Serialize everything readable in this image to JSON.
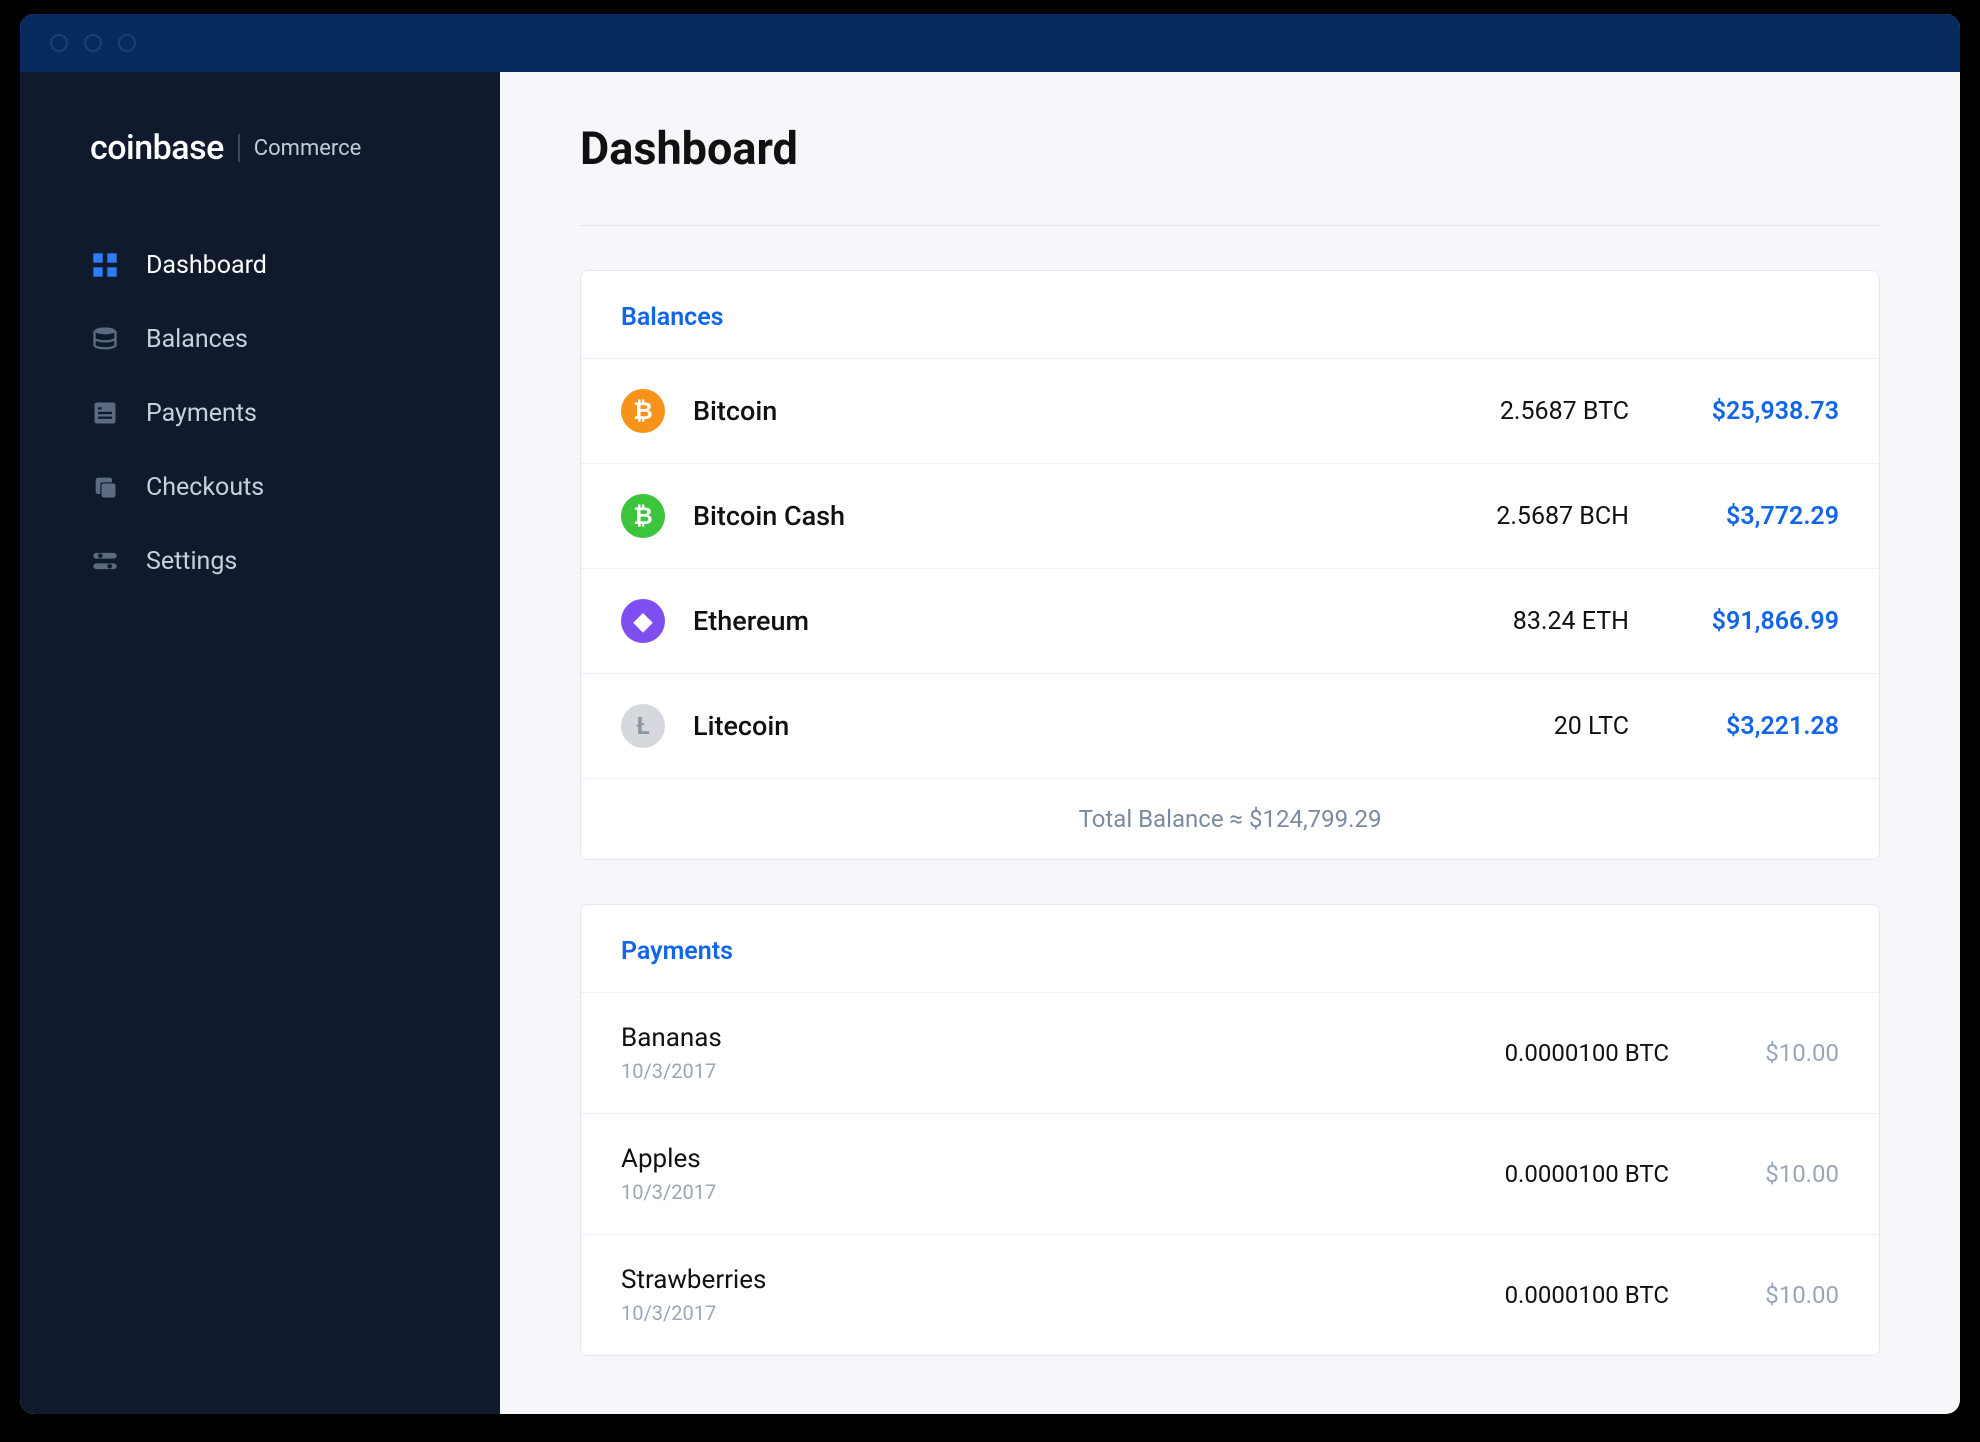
{
  "brand": {
    "primary": "coinbase",
    "secondary": "Commerce"
  },
  "sidebar": {
    "items": [
      {
        "label": "Dashboard",
        "icon": "dashboard-icon",
        "active": true
      },
      {
        "label": "Balances",
        "icon": "balances-icon",
        "active": false
      },
      {
        "label": "Payments",
        "icon": "payments-icon",
        "active": false
      },
      {
        "label": "Checkouts",
        "icon": "checkouts-icon",
        "active": false
      },
      {
        "label": "Settings",
        "icon": "settings-icon",
        "active": false
      }
    ]
  },
  "page": {
    "title": "Dashboard"
  },
  "balances": {
    "title": "Balances",
    "rows": [
      {
        "name": "Bitcoin",
        "amount": "2.5687 BTC",
        "usd": "$25,938.73",
        "color": "#f7931a",
        "symbol": "₿"
      },
      {
        "name": "Bitcoin Cash",
        "amount": "2.5687 BCH",
        "usd": "$3,772.29",
        "color": "#3cc43c",
        "symbol": "₿"
      },
      {
        "name": "Ethereum",
        "amount": "83.24 ETH",
        "usd": "$91,866.99",
        "color": "#7e4ef0",
        "symbol": "◆"
      },
      {
        "name": "Litecoin",
        "amount": "20 LTC",
        "usd": "$3,221.28",
        "color": "#d5d9de",
        "symbol": "Ł"
      }
    ],
    "total_label": "Total Balance ≈",
    "total_value": "$124,799.29"
  },
  "payments": {
    "title": "Payments",
    "rows": [
      {
        "name": "Bananas",
        "date": "10/3/2017",
        "amount": "0.0000100 BTC",
        "usd": "$10.00"
      },
      {
        "name": "Apples",
        "date": "10/3/2017",
        "amount": "0.0000100 BTC",
        "usd": "$10.00"
      },
      {
        "name": "Strawberries",
        "date": "10/3/2017",
        "amount": "0.0000100 BTC",
        "usd": "$10.00"
      }
    ]
  },
  "colors": {
    "accent": "#1165e8"
  }
}
